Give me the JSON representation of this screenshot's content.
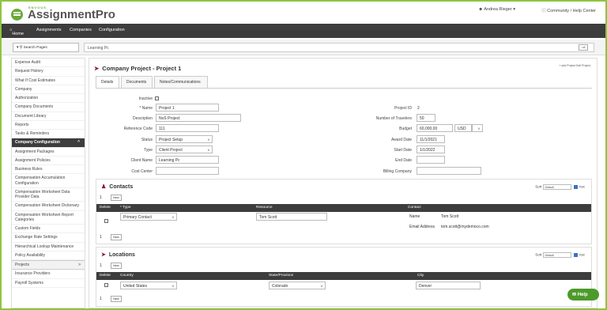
{
  "header": {
    "brand_small": "ENVOUS",
    "brand": "AssignmentPro",
    "user": "Andrea Rieger",
    "help_link": "Community / Help Center"
  },
  "nav": {
    "home": "Home",
    "assignments": "Assignments",
    "companies": "Companies",
    "configuration": "Configuration"
  },
  "search": {
    "placeholder": "Search Pages"
  },
  "breadcrumb": "Learning Pc",
  "breadcrumb_btn": "=A",
  "sidebar": {
    "items": [
      "Expense Audit",
      "Request History",
      "What If Cost Estimates",
      "Company",
      "Authorization",
      "Company Documents",
      "Document Library",
      "Reports",
      "Tasks & Reminders"
    ],
    "active": "Company Configuration",
    "sub_items": [
      "Assignment Packages",
      "Assignment Policies",
      "Business Rules",
      "Compensation Accumulation Configuration",
      "Compensation Worksheet Data Provider Data",
      "Compensation Worksheet Dictionary",
      "Compensation Worksheet Report Categories",
      "Custom Fields",
      "Exchange Rate Settings",
      "Hierarchical Lookup Maintenance",
      "Policy Availability"
    ],
    "group": "Projects",
    "after": [
      "Insurance Providers",
      "Payroll Systems"
    ]
  },
  "page": {
    "title": "Company Project - Project 1",
    "actions": "+ add Project  Edit Project",
    "tabs": [
      "Details",
      "Documents",
      "Notes/Communications"
    ]
  },
  "form": {
    "inactive_label": "Inactive",
    "name_label": "* Name",
    "name": "Project 1",
    "desc_label": "Description",
    "desc": "NoS Project",
    "ref_label": "Reference Code",
    "ref": "111",
    "status_label": "Status",
    "status": "Project Setup",
    "type_label": "Type",
    "type": "Client Project",
    "client_label": "Client Name",
    "client": "Learning Pc",
    "cost_label": "Cost Center",
    "cost": "",
    "pid_label": "Project ID",
    "pid": "2",
    "travelers_label": "Number of Travelers",
    "travelers": "50",
    "budget_label": "Budget",
    "budget": "60,000.00",
    "currency": "USD",
    "award_label": "Award Date",
    "award": "11/1/2021",
    "start_label": "Start Date",
    "start": "1/1/2022",
    "end_label": "End Date",
    "end": "",
    "billing_label": "Billing Company",
    "billing": ""
  },
  "contacts": {
    "title": "Contacts",
    "sort_label": "Sort",
    "sort_value": "Default",
    "asc": "Asc",
    "page": "1",
    "new_btn": "New",
    "cols": [
      "Delete",
      "* Type",
      "Resource",
      "Contact"
    ],
    "row": {
      "type": "Primary Contact",
      "resource": "Tom Scott",
      "name_label": "Name",
      "name": "Tom Scott",
      "email_label": "Email Address",
      "email": "tom.scott@mydemoco.com"
    }
  },
  "locations": {
    "title": "Locations",
    "sort_label": "Sort",
    "sort_value": "Default",
    "asc": "Asc",
    "page": "1",
    "new_btn": "New",
    "cols": [
      "Delete",
      "Country",
      "State/Province",
      "City"
    ],
    "row": {
      "country": "United States",
      "state": "Colorado",
      "city": "Denver"
    }
  },
  "help_btn": "Help",
  "colors": {
    "brand_green": "#6aaa3a",
    "nav_dark": "#3d3d3d",
    "accent": "#8b1c3e"
  }
}
